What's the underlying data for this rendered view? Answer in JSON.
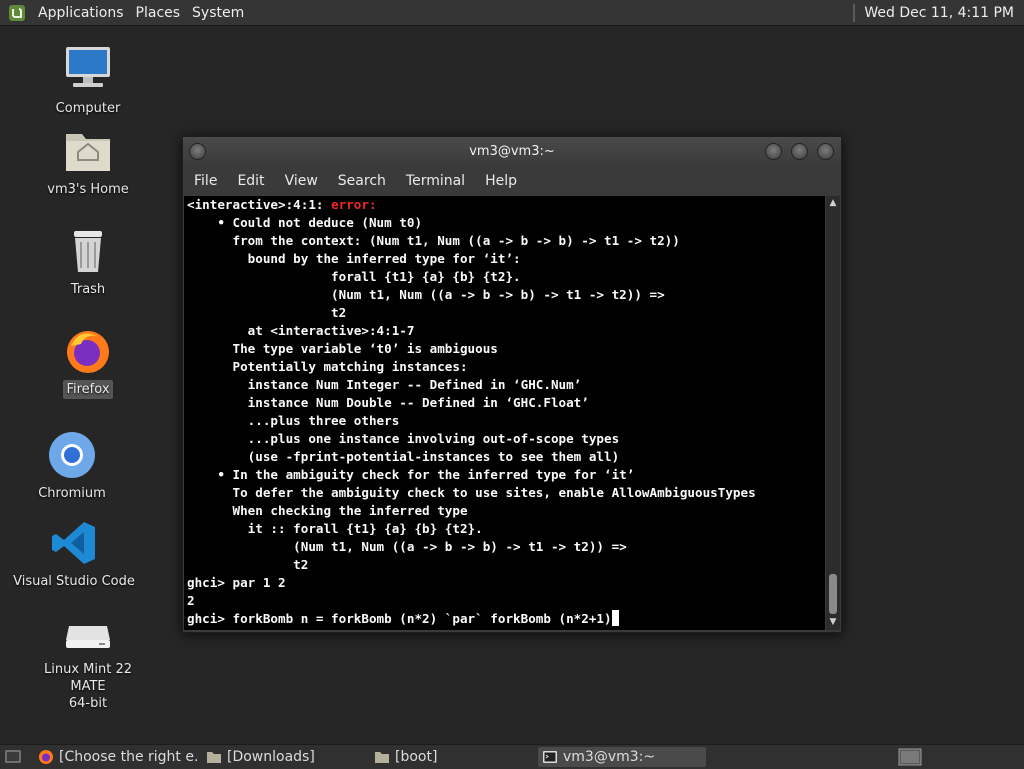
{
  "top_panel": {
    "menus": [
      "Applications",
      "Places",
      "System"
    ],
    "clock": "Wed Dec 11,  4:11 PM"
  },
  "desktop_icons": [
    {
      "label": "Computer",
      "icon": "computer-icon"
    },
    {
      "label": "vm3's Home",
      "icon": "home-folder-icon"
    },
    {
      "label": "Trash",
      "icon": "trash-icon"
    },
    {
      "label": "Firefox",
      "icon": "firefox-icon",
      "selected": true
    },
    {
      "label": "Chromium",
      "icon": "chromium-icon"
    },
    {
      "label": "Visual Studio Code",
      "icon": "vscode-icon"
    },
    {
      "label": "Linux Mint 22 MATE\n64-bit",
      "icon": "drive-icon"
    }
  ],
  "terminal": {
    "title": "vm3@vm3:~",
    "menu": [
      "File",
      "Edit",
      "View",
      "Search",
      "Terminal",
      "Help"
    ],
    "error_prefix": "<interactive>:4:1: ",
    "error_word": "error:",
    "lines": [
      "    • Could not deduce (Num t0)",
      "      from the context: (Num t1, Num ((a -> b -> b) -> t1 -> t2))",
      "        bound by the inferred type for ‘it’:",
      "                   forall {t1} {a} {b} {t2}.",
      "                   (Num t1, Num ((a -> b -> b) -> t1 -> t2)) =>",
      "                   t2",
      "        at <interactive>:4:1-7",
      "      The type variable ‘t0’ is ambiguous",
      "      Potentially matching instances:",
      "        instance Num Integer -- Defined in ‘GHC.Num’",
      "        instance Num Double -- Defined in ‘GHC.Float’",
      "        ...plus three others",
      "        ...plus one instance involving out-of-scope types",
      "        (use -fprint-potential-instances to see them all)",
      "    • In the ambiguity check for the inferred type for ‘it’",
      "      To defer the ambiguity check to use sites, enable AllowAmbiguousTypes",
      "      When checking the inferred type",
      "        it :: forall {t1} {a} {b} {t2}.",
      "              (Num t1, Num ((a -> b -> b) -> t1 -> t2)) =>",
      "              t2",
      "ghci> par 1 2",
      "2"
    ],
    "prompt_line": "ghci> forkBomb n = forkBomb (n*2) `par` forkBomb (n*2+1)"
  },
  "taskbar": {
    "tasks": [
      {
        "label": "[Choose the right e...",
        "icon": "firefox-icon"
      },
      {
        "label": "[Downloads]",
        "icon": "folder-icon"
      },
      {
        "label": "[boot]",
        "icon": "folder-icon"
      },
      {
        "label": "vm3@vm3:~",
        "icon": "terminal-icon",
        "active": true
      }
    ]
  },
  "colors": {
    "error": "#ef2929",
    "terminal_bg": "#000000",
    "desktop_bg": "#262626"
  }
}
